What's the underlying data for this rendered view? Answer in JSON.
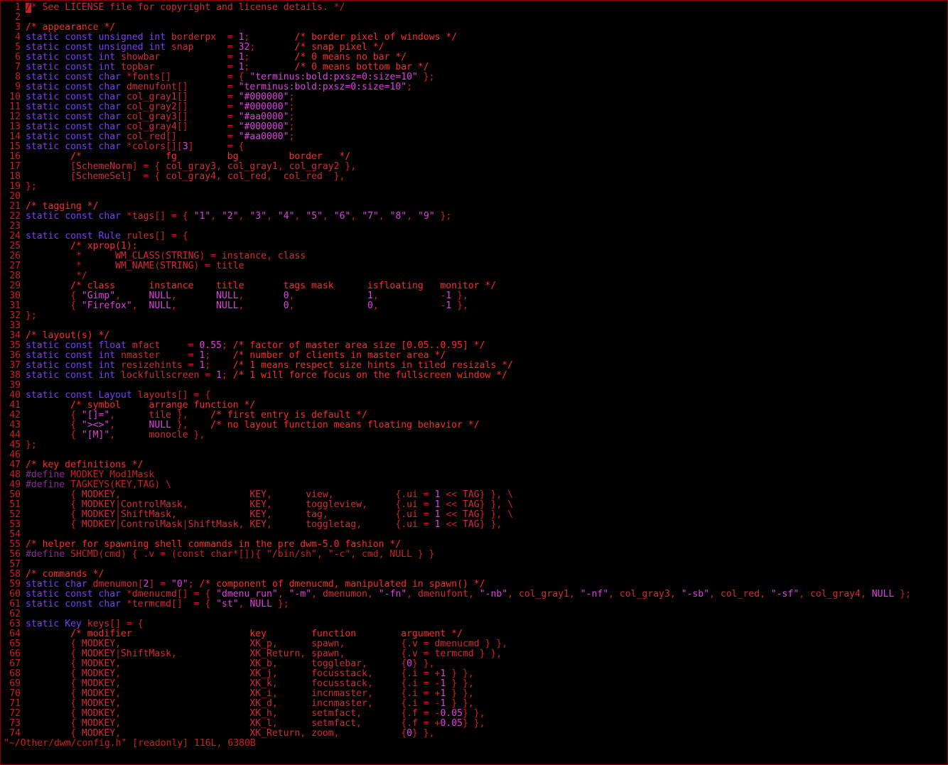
{
  "status_line": "\"~/Other/dwm/config.h\" [readonly] 116L, 6380B",
  "colors": {
    "background": "#000000",
    "border": "#8a0000",
    "text": "#cc2020",
    "keyword": "#7a3cff",
    "comment": "#ff2a2a",
    "string": "#e040e0",
    "preprocessor": "#8a2a9a"
  },
  "lines": [
    {
      "n": "1",
      "t": "/* See LICENSE file for copyright and license details. */"
    },
    {
      "n": "2",
      "t": ""
    },
    {
      "n": "3",
      "t": "/* appearance */"
    },
    {
      "n": "4",
      "t": "static const unsigned int borderpx  = 1;        /* border pixel of windows */"
    },
    {
      "n": "5",
      "t": "static const unsigned int snap      = 32;       /* snap pixel */"
    },
    {
      "n": "6",
      "t": "static const int showbar            = 1;        /* 0 means no bar */"
    },
    {
      "n": "7",
      "t": "static const int topbar             = 1;        /* 0 means bottom bar */"
    },
    {
      "n": "8",
      "t": "static const char *fonts[]          = { \"terminus:bold:pxsz=0:size=10\" };"
    },
    {
      "n": "9",
      "t": "static const char dmenufont[]       = \"terminus:bold:pxsz=0:size=10\";"
    },
    {
      "n": "10",
      "t": "static const char col_gray1[]       = \"#000000\";"
    },
    {
      "n": "11",
      "t": "static const char col_gray2[]       = \"#000000\";"
    },
    {
      "n": "12",
      "t": "static const char col_gray3[]       = \"#aa0000\";"
    },
    {
      "n": "13",
      "t": "static const char col_gray4[]       = \"#000000\";"
    },
    {
      "n": "14",
      "t": "static const char col_red[]         = \"#aa0000\";"
    },
    {
      "n": "15",
      "t": "static const char *colors[][3]      = {"
    },
    {
      "n": "16",
      "t": "        /*               fg         bg         border   */"
    },
    {
      "n": "17",
      "t": "        [SchemeNorm] = { col_gray3, col_gray1, col_gray2 },"
    },
    {
      "n": "18",
      "t": "        [SchemeSel]  = { col_gray4, col_red,  col_red  },"
    },
    {
      "n": "19",
      "t": "};"
    },
    {
      "n": "20",
      "t": ""
    },
    {
      "n": "21",
      "t": "/* tagging */"
    },
    {
      "n": "22",
      "t": "static const char *tags[] = { \"1\", \"2\", \"3\", \"4\", \"5\", \"6\", \"7\", \"8\", \"9\" };"
    },
    {
      "n": "23",
      "t": ""
    },
    {
      "n": "24",
      "t": "static const Rule rules[] = {"
    },
    {
      "n": "25",
      "t": "        /* xprop(1):"
    },
    {
      "n": "26",
      "t": "         *      WM_CLASS(STRING) = instance, class"
    },
    {
      "n": "27",
      "t": "         *      WM_NAME(STRING) = title"
    },
    {
      "n": "28",
      "t": "         */"
    },
    {
      "n": "29",
      "t": "        /* class      instance    title       tags mask      isfloating   monitor */"
    },
    {
      "n": "30",
      "t": "        { \"Gimp\",     NULL,       NULL,       0,             1,           -1 },"
    },
    {
      "n": "31",
      "t": "        { \"Firefox\",  NULL,       NULL,       0,             0,           -1 },"
    },
    {
      "n": "32",
      "t": "};"
    },
    {
      "n": "33",
      "t": ""
    },
    {
      "n": "34",
      "t": "/* layout(s) */"
    },
    {
      "n": "35",
      "t": "static const float mfact     = 0.55; /* factor of master area size [0.05..0.95] */"
    },
    {
      "n": "36",
      "t": "static const int nmaster     = 1;    /* number of clients in master area */"
    },
    {
      "n": "37",
      "t": "static const int resizehints = 1;    /* 1 means respect size hints in tiled resizals */"
    },
    {
      "n": "38",
      "t": "static const int lockfullscreen = 1; /* 1 will force focus on the fullscreen window */"
    },
    {
      "n": "39",
      "t": ""
    },
    {
      "n": "40",
      "t": "static const Layout layouts[] = {"
    },
    {
      "n": "41",
      "t": "        /* symbol     arrange function */"
    },
    {
      "n": "42",
      "t": "        { \"[]=\",      tile },    /* first entry is default */"
    },
    {
      "n": "43",
      "t": "        { \"><>\",      NULL },    /* no layout function means floating behavior */"
    },
    {
      "n": "44",
      "t": "        { \"[M]\",      monocle },"
    },
    {
      "n": "45",
      "t": "};"
    },
    {
      "n": "46",
      "t": ""
    },
    {
      "n": "47",
      "t": "/* key definitions */"
    },
    {
      "n": "48",
      "t": "#define MODKEY Mod1Mask"
    },
    {
      "n": "49",
      "t": "#define TAGKEYS(KEY,TAG) \\"
    },
    {
      "n": "50",
      "t": "        { MODKEY,                       KEY,      view,           {.ui = 1 << TAG} }, \\"
    },
    {
      "n": "51",
      "t": "        { MODKEY|ControlMask,           KEY,      toggleview,     {.ui = 1 << TAG} }, \\"
    },
    {
      "n": "52",
      "t": "        { MODKEY|ShiftMask,             KEY,      tag,            {.ui = 1 << TAG} }, \\"
    },
    {
      "n": "53",
      "t": "        { MODKEY|ControlMask|ShiftMask, KEY,      toggletag,      {.ui = 1 << TAG} },"
    },
    {
      "n": "54",
      "t": ""
    },
    {
      "n": "55",
      "t": "/* helper for spawning shell commands in the pre dwm-5.0 fashion */"
    },
    {
      "n": "56",
      "t": "#define SHCMD(cmd) { .v = (const char*[]){ \"/bin/sh\", \"-c\", cmd, NULL } }"
    },
    {
      "n": "57",
      "t": ""
    },
    {
      "n": "58",
      "t": "/* commands */"
    },
    {
      "n": "59",
      "t": "static char dmenumon[2] = \"0\"; /* component of dmenucmd, manipulated in spawn() */"
    },
    {
      "n": "60",
      "t": "static const char *dmenucmd[] = { \"dmenu_run\", \"-m\", dmenumon, \"-fn\", dmenufont, \"-nb\", col_gray1, \"-nf\", col_gray3, \"-sb\", col_red, \"-sf\", col_gray4, NULL };"
    },
    {
      "n": "61",
      "t": "static const char *termcmd[]  = { \"st\", NULL };"
    },
    {
      "n": "62",
      "t": ""
    },
    {
      "n": "63",
      "t": "static Key keys[] = {"
    },
    {
      "n": "64",
      "t": "        /* modifier                     key        function        argument */"
    },
    {
      "n": "65",
      "t": "        { MODKEY,                       XK_p,      spawn,          {.v = dmenucmd } },"
    },
    {
      "n": "66",
      "t": "        { MODKEY|ShiftMask,             XK_Return, spawn,          {.v = termcmd } },"
    },
    {
      "n": "67",
      "t": "        { MODKEY,                       XK_b,      togglebar,      {0} },"
    },
    {
      "n": "68",
      "t": "        { MODKEY,                       XK_j,      focusstack,     {.i = +1 } },"
    },
    {
      "n": "69",
      "t": "        { MODKEY,                       XK_k,      focusstack,     {.i = -1 } },"
    },
    {
      "n": "70",
      "t": "        { MODKEY,                       XK_i,      incnmaster,     {.i = +1 } },"
    },
    {
      "n": "71",
      "t": "        { MODKEY,                       XK_d,      incnmaster,     {.i = -1 } },"
    },
    {
      "n": "72",
      "t": "        { MODKEY,                       XK_h,      setmfact,       {.f = -0.05} },"
    },
    {
      "n": "73",
      "t": "        { MODKEY,                       XK_l,      setmfact,       {.f = +0.05} },"
    },
    {
      "n": "74",
      "t": "        { MODKEY,                       XK_Return, zoom,           {0} },"
    }
  ]
}
